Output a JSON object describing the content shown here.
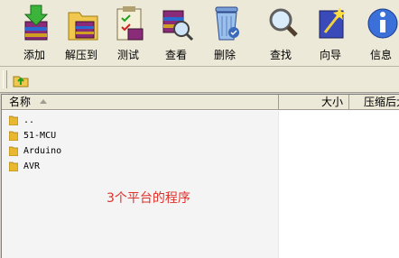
{
  "toolbar": {
    "buttons": [
      {
        "label": "添加",
        "icon": "add-icon"
      },
      {
        "label": "解压到",
        "icon": "extract-icon"
      },
      {
        "label": "测试",
        "icon": "test-icon"
      },
      {
        "label": "查看",
        "icon": "view-icon"
      },
      {
        "label": "删除",
        "icon": "delete-icon"
      },
      {
        "label": "查找",
        "icon": "find-icon"
      },
      {
        "label": "向导",
        "icon": "wizard-icon"
      },
      {
        "label": "信息",
        "icon": "info-icon"
      }
    ]
  },
  "columns": {
    "name": "名称",
    "size": "大小",
    "packed": "压缩后大"
  },
  "files": [
    {
      "name": ".."
    },
    {
      "name": "51-MCU"
    },
    {
      "name": "Arduino"
    },
    {
      "name": "AVR"
    }
  ],
  "annotation": "3个平台的程序",
  "colors": {
    "annotation": "#e0302a",
    "folder": "#e8b830"
  }
}
